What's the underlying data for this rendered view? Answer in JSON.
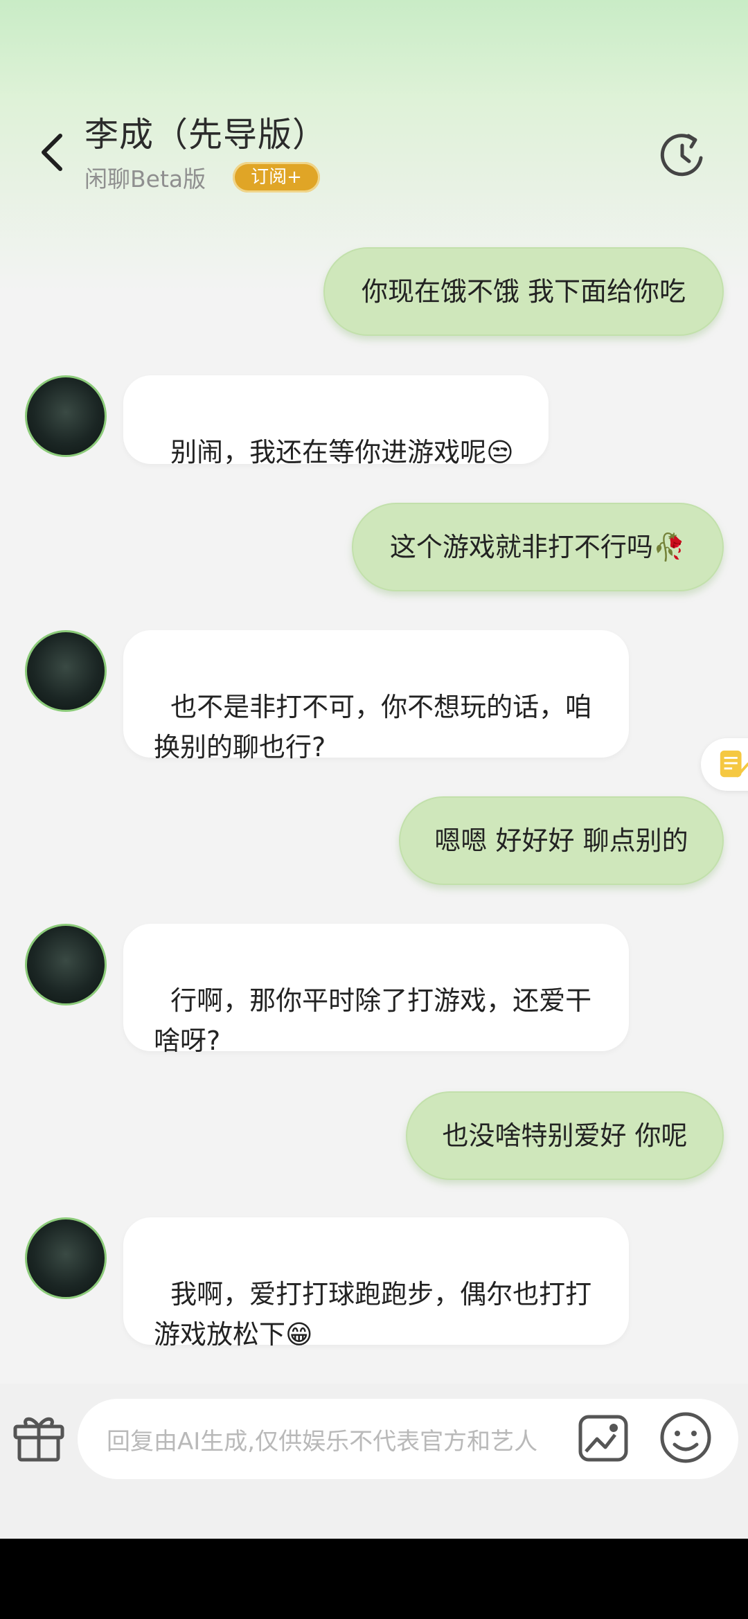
{
  "header": {
    "title": "李成（先导版）",
    "subtitle": "闲聊Beta版",
    "badge": "订阅+"
  },
  "messages": [
    {
      "from": "user",
      "text": "你现在饿不饿 我下面给你吃"
    },
    {
      "from": "bot",
      "text": "别闹，我还在等你进游戏呢😒"
    },
    {
      "from": "user",
      "text": "这个游戏就非打不行吗🥀"
    },
    {
      "from": "bot",
      "text": "也不是非打不可，你不想玩的话，咱\n换别的聊也行?"
    },
    {
      "from": "user",
      "text": "嗯嗯 好好好 聊点别的"
    },
    {
      "from": "bot",
      "text": "行啊，那你平时除了打游戏，还爱干\n啥呀?"
    },
    {
      "from": "user",
      "text": "也没啥特别爱好 你呢"
    },
    {
      "from": "bot",
      "text": "我啊，爱打打球跑跑步，偶尔也打打\n游戏放松下😁"
    }
  ],
  "input": {
    "placeholder": "回复由AI生成,仅供娱乐不代表官方和艺人"
  },
  "icons": {
    "back": "back-arrow-icon",
    "refresh": "refresh-icon",
    "note": "note-icon",
    "gift": "gift-icon",
    "image": "image-icon",
    "emoji": "emoji-icon"
  },
  "colors": {
    "user_bubble": "#cfe7bb",
    "bot_bubble": "#ffffff",
    "badge": "#e0a526",
    "avatar_border": "#8ccb7a"
  }
}
